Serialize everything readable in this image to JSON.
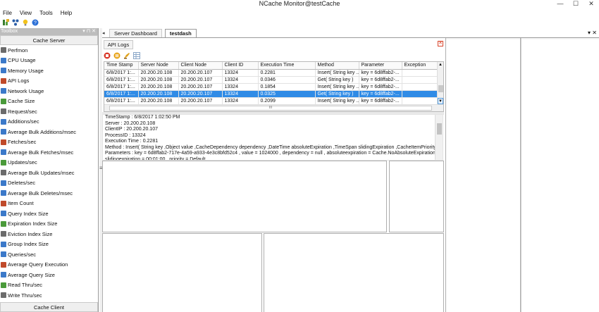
{
  "window": {
    "title": "NCache Monitor@testCache",
    "minimize": "—",
    "maximize": "☐",
    "close": "✕"
  },
  "menu": [
    "File",
    "View",
    "Tools",
    "Help"
  ],
  "toolbar_icons": [
    "add-counter-icon",
    "network-icon",
    "bulb-icon",
    "help-icon"
  ],
  "toolbox": {
    "title": "Toolbox",
    "controls": "▾ ⊓ ✕",
    "cache_server_label": "Cache Server",
    "cache_client_label": "Cache Client",
    "counters": [
      "Perfmon",
      "CPU Usage",
      "Memory Usage",
      "API Logs",
      "Network Usage",
      "Cache Size",
      "Request/sec",
      "Additions/sec",
      "Average Bulk Additions/msec",
      "Fetches/sec",
      "Average Bulk Fetches/msec",
      "Updates/sec",
      "Average Bulk Updates/msec",
      "Deletes/sec",
      "Average Bulk Deletes/msec",
      "Item Count",
      "Query Index Size",
      "Expiration Index Size",
      "Eviction Index Size",
      "Group Index Size",
      "Queries/sec",
      "Average Query Execution",
      "Average Query Size",
      "Read Thru/sec",
      "Write Thru/sec"
    ]
  },
  "doc_tabs": [
    "Server Dashboard",
    "testdash"
  ],
  "doc_controls": "▾ ✕",
  "api_logs": {
    "tab_label": "API Logs",
    "close": "✕",
    "columns": [
      "Time Stamp",
      "Server Node",
      "Client Node",
      "Client ID",
      "Execution Time",
      "Method",
      "Parameter",
      "Exception"
    ],
    "rows": [
      [
        "6/8/2017 1:...",
        "20.200.20.108",
        "20.200.20.107",
        "13324",
        "0.2281",
        "Insert( String key ...",
        "key = 6d8ffab2-...",
        ""
      ],
      [
        "6/8/2017 1:...",
        "20.200.20.108",
        "20.200.20.107",
        "13324",
        "0.0346",
        "Get( String key )",
        "key = 6d8ffab2-...",
        ""
      ],
      [
        "6/8/2017 1:...",
        "20.200.20.108",
        "20.200.20.107",
        "13324",
        "0.1854",
        "Insert( String key ...",
        "key = 6d8ffab2-...",
        ""
      ],
      [
        "6/8/2017 1:...",
        "20.200.20.108",
        "20.200.20.107",
        "13324",
        "0.0325",
        "Get( String key )",
        "key = 6d8ffab2-...",
        ""
      ],
      [
        "6/8/2017 1:...",
        "20.200.20.108",
        "20.200.20.107",
        "13324",
        "0.2099",
        "Insert( String key ...",
        "key = 6d8ffab2-...",
        ""
      ]
    ],
    "selected_row": 3,
    "hscroll_grip": "III",
    "details": [
      "TimeStamp : 6/8/2017 1:02:50 PM",
      "Server : 20.200.20.108",
      "ClientIP : 20.200.20.107",
      "ProcessID : 13324",
      "Execution Time : 0.2281",
      "Method : Insert( String key ,Object value ,CacheDependency dependency ,DateTime absoluteExpiration ,TimeSpan slidingExpiration ,CacheItemPriority pri",
      "Parameters : key = 6d8ffab2-717e-4a59-a933-4e3c8bfd52c4 , value = 1024000 , dependency = null , absoluteexpiration = Cache.NoAbsoluteExpiration ,",
      "slidingexpiration = 00:01:00 , priority = Default"
    ]
  },
  "colors": {
    "selection": "#2f8be6",
    "close_red": "#d9442a"
  }
}
